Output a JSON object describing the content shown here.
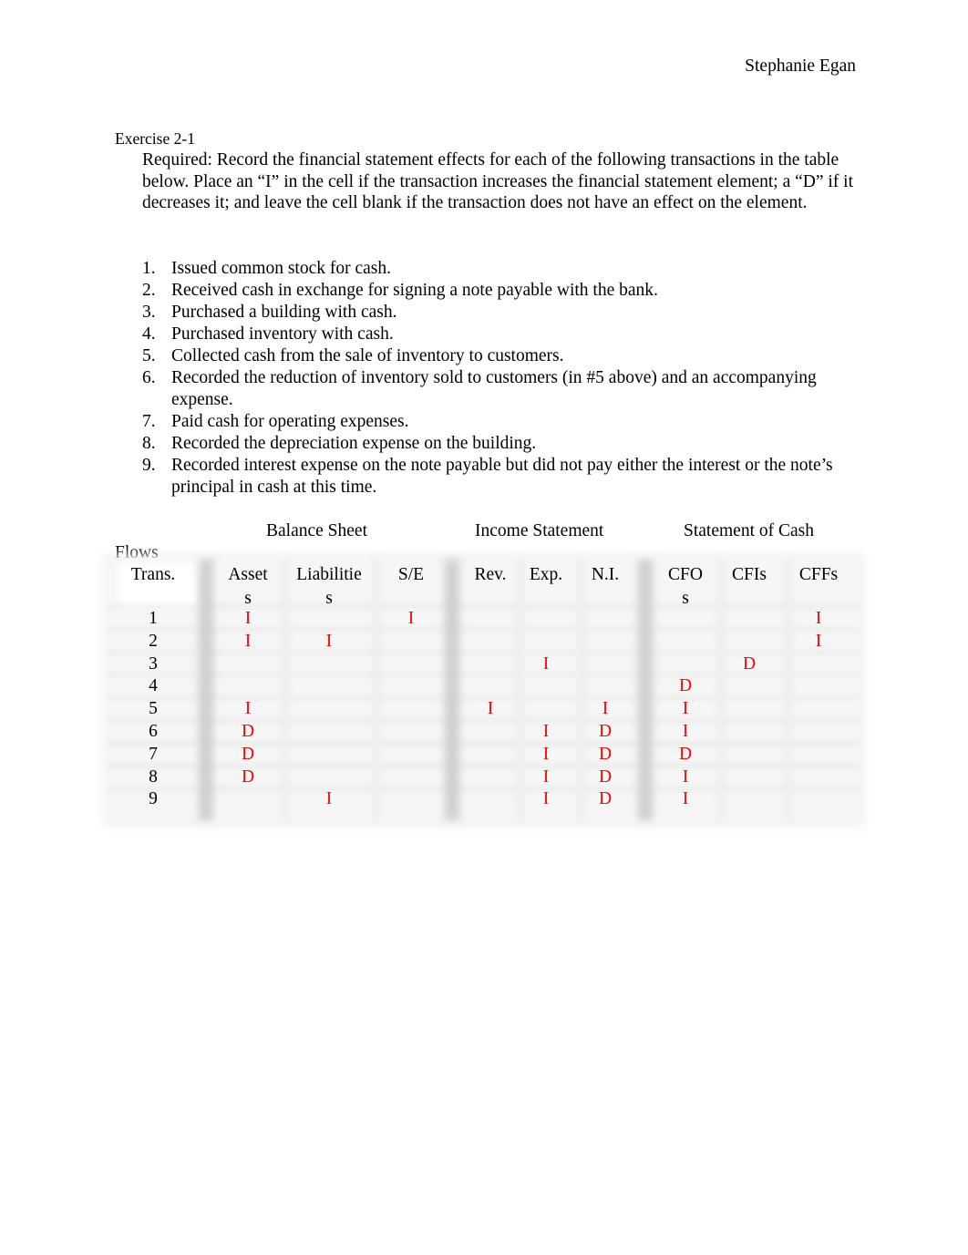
{
  "author": "Stephanie Egan",
  "exercise_title": "Exercise 2-1",
  "instructions": "Required:  Record the financial statement effects for each of the following transactions in the table below. Place an “I” in the cell if the transaction increases the financial statement element; a “D” if it decreases it; and leave the cell blank if the transaction does not have an effect on the element.",
  "transactions": [
    {
      "num": "1.",
      "text": "Issued common stock for cash."
    },
    {
      "num": "2.",
      "text": "Received cash in exchange for signing a note payable with the bank."
    },
    {
      "num": "3.",
      "text": "Purchased a building with cash."
    },
    {
      "num": "4.",
      "text": "Purchased inventory with cash."
    },
    {
      "num": "5.",
      "text": "Collected cash from the sale of inventory to customers."
    },
    {
      "num": "6.",
      "text": "Recorded the reduction of inventory sold to customers (in #5 above) and an accompanying  expense."
    },
    {
      "num": "7.",
      "text": "Paid cash for operating expenses."
    },
    {
      "num": "8.",
      "text": "Recorded the depreciation expense on the building."
    },
    {
      "num": "9.",
      "text": "Recorded interest expense on the note payable but did not pay either the interest or the note’s principal in cash at this time."
    }
  ],
  "table": {
    "group_headers": {
      "balance_sheet": "Balance Sheet",
      "income_statement": "Income Statement",
      "cash_flows_line1": "Statement of Cash",
      "cash_flows_line2": "Flows"
    },
    "columns": {
      "trans": "Trans.",
      "assets": "Asset\ns",
      "liabilities": "Liabilitie\ns",
      "se": "S/E",
      "rev": "Rev.",
      "exp": "Exp.",
      "ni": "N.I.",
      "cfo": "CFO\ns",
      "cfi": "CFIs",
      "cff": "CFFs"
    },
    "rows": [
      {
        "trans": "1",
        "assets": "I",
        "liabilities": "",
        "se": "I",
        "rev": "",
        "exp": "",
        "ni": "",
        "cfo": "",
        "cfi": "",
        "cff": "I"
      },
      {
        "trans": "2",
        "assets": "I",
        "liabilities": "I",
        "se": "",
        "rev": "",
        "exp": "",
        "ni": "",
        "cfo": "",
        "cfi": "",
        "cff": "I"
      },
      {
        "trans": "3",
        "assets": "",
        "liabilities": "",
        "se": "",
        "rev": "",
        "exp": "I",
        "ni": "",
        "cfo": "",
        "cfi": "D",
        "cff": ""
      },
      {
        "trans": "4",
        "assets": "",
        "liabilities": "",
        "se": "",
        "rev": "",
        "exp": "",
        "ni": "",
        "cfo": "D",
        "cfi": "",
        "cff": ""
      },
      {
        "trans": "5",
        "assets": "I",
        "liabilities": "",
        "se": "",
        "rev": "I",
        "exp": "",
        "ni": "I",
        "cfo": "I",
        "cfi": "",
        "cff": ""
      },
      {
        "trans": "6",
        "assets": "D",
        "liabilities": "",
        "se": "",
        "rev": "",
        "exp": "I",
        "ni": "D",
        "cfo": "I",
        "cfi": "",
        "cff": ""
      },
      {
        "trans": "7",
        "assets": "D",
        "liabilities": "",
        "se": "",
        "rev": "",
        "exp": "I",
        "ni": "D",
        "cfo": "D",
        "cfi": "",
        "cff": ""
      },
      {
        "trans": "8",
        "assets": "D",
        "liabilities": "",
        "se": "",
        "rev": "",
        "exp": "I",
        "ni": "D",
        "cfo": "I",
        "cfi": "",
        "cff": ""
      },
      {
        "trans": "9",
        "assets": "",
        "liabilities": "I",
        "se": "",
        "rev": "",
        "exp": "I",
        "ni": "D",
        "cfo": "I",
        "cfi": "",
        "cff": ""
      }
    ]
  },
  "colors": {
    "answer": "#ff0000",
    "text": "#000000"
  }
}
